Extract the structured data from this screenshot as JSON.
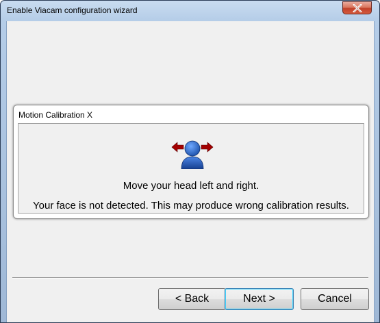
{
  "window": {
    "title": "Enable Viacam configuration wizard",
    "close_icon": "close-x-icon"
  },
  "panel": {
    "title": "Motion Calibration X",
    "icon": "head-left-right-icon",
    "instruction": "Move your head left and right.",
    "warning": "Your face is not detected. This may produce wrong calibration results."
  },
  "buttons": {
    "back": "< Back",
    "next": "Next >",
    "cancel": "Cancel"
  },
  "colors": {
    "person": "#1f5fbf",
    "arrows": "#a30000",
    "close_button": "#c9503a"
  }
}
